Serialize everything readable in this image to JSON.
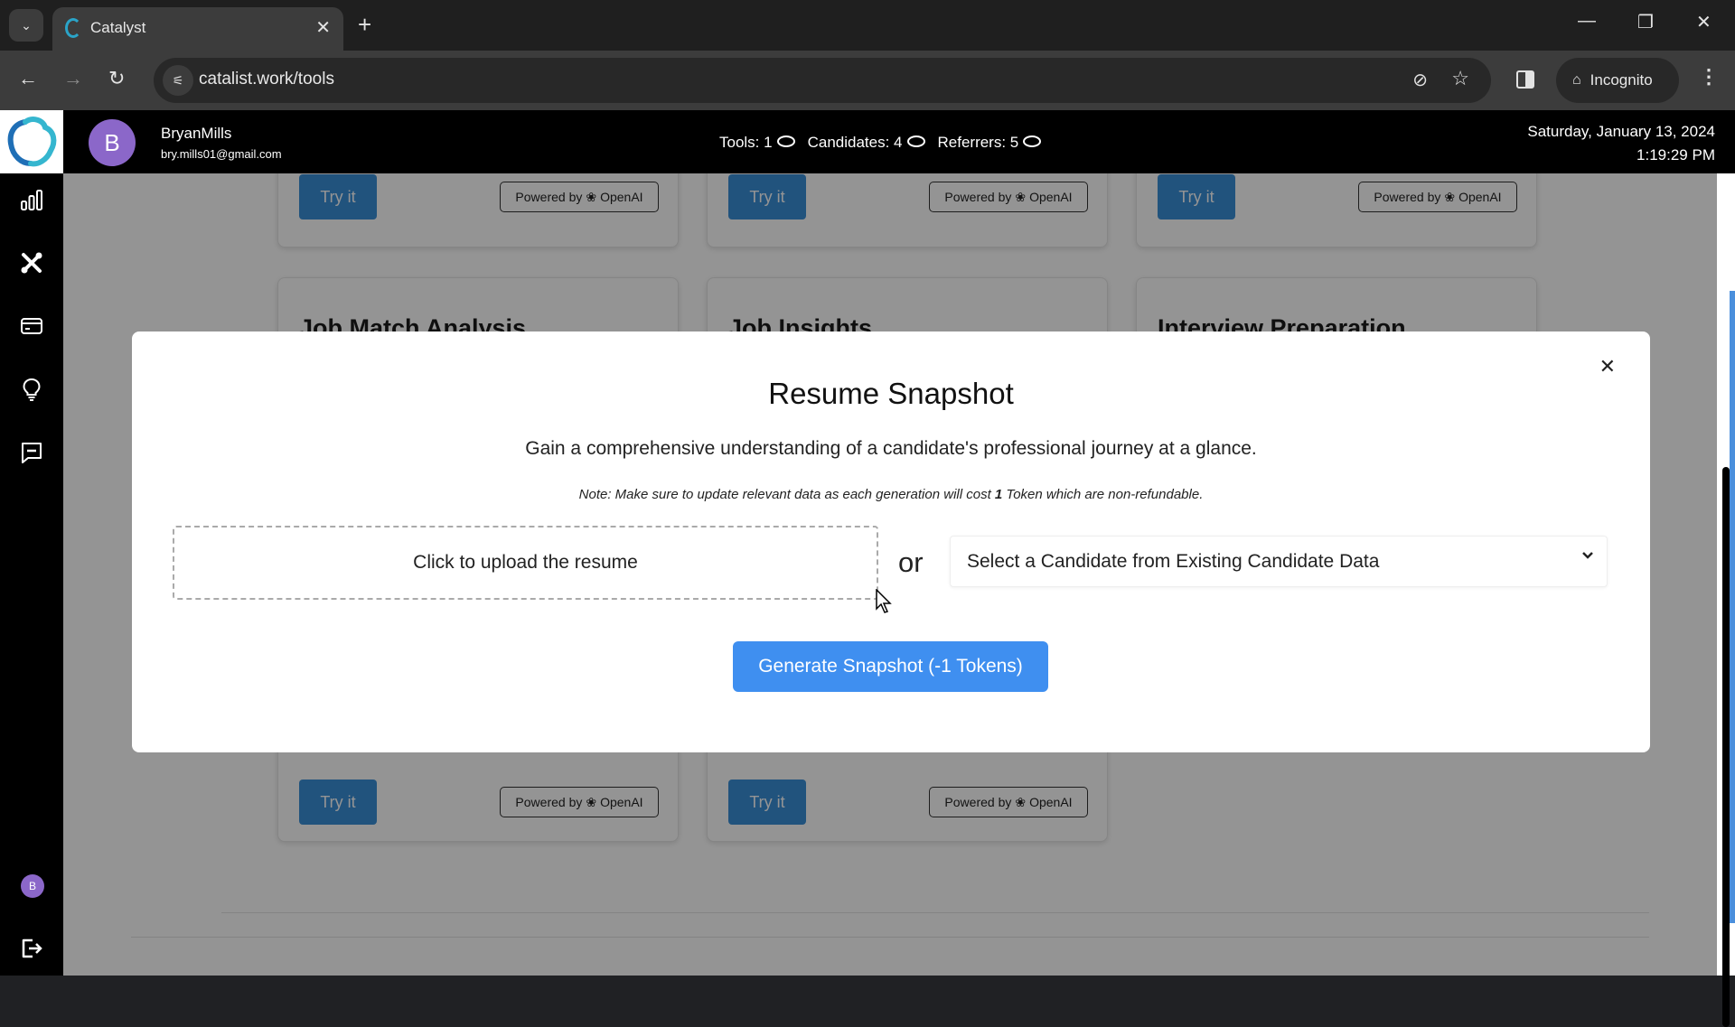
{
  "browser": {
    "tab_title": "Catalyst",
    "url": "catalist.work/tools",
    "incognito_label": "Incognito",
    "icons": {
      "tab_list": "chevron-down-icon",
      "tab_close": "close-icon",
      "new_tab": "plus-icon",
      "back": "arrow-left-icon",
      "forward": "arrow-right-icon",
      "reload": "reload-icon",
      "site_info": "tune-icon",
      "tracking": "eye-off-icon",
      "bookmark": "star-icon",
      "side_panel": "side-panel-icon",
      "incognito": "incognito-icon",
      "menu": "more-vertical-icon",
      "minimize": "minimize-icon",
      "restore": "restore-icon",
      "close_window": "close-icon"
    },
    "glyphs": {
      "tab_list": "⌄",
      "tab_close": "✕",
      "new_tab": "+",
      "back": "←",
      "forward": "→",
      "reload": "↻",
      "site_info": "⚟",
      "tracking": "⊘",
      "bookmark": "☆",
      "incognito": "🕵",
      "menu": "⋮",
      "minimize": "—",
      "restore": "❐",
      "close_window": "✕"
    }
  },
  "header": {
    "avatar_initial": "B",
    "user_name": "BryanMills",
    "user_email": "bry.mills01@gmail.com",
    "counters": [
      {
        "label": "Tools: 1"
      },
      {
        "label": "Candidates: 4"
      },
      {
        "label": "Referrers: 5"
      }
    ],
    "date": "Saturday, January 13, 2024",
    "time": "1:19:29 PM"
  },
  "sidebar": {
    "items": [
      {
        "name": "analytics",
        "icon": "bar-chart-icon"
      },
      {
        "name": "tools",
        "icon": "tools-icon"
      },
      {
        "name": "billing",
        "icon": "credit-card-icon"
      },
      {
        "name": "ideas",
        "icon": "lightbulb-icon"
      },
      {
        "name": "messages",
        "icon": "message-icon"
      }
    ],
    "avatar_initial": "B",
    "logout_icon": "logout-icon"
  },
  "background_cards": {
    "try_label": "Try it",
    "powered_label": "Powered by",
    "powered_brand": "OpenAI",
    "titles": [
      "Job Match Analysis",
      "Job Insights",
      "Interview Preparation"
    ]
  },
  "modal": {
    "title": "Resume Snapshot",
    "subtitle": "Gain a comprehensive understanding of a candidate's professional journey at a glance.",
    "note_prefix": "Note: Make sure to update relevant data as each generation will cost ",
    "note_count": "1",
    "note_suffix": " Token which are non-refundable.",
    "upload_label": "Click to upload the resume",
    "or_label": "or",
    "select_placeholder": "Select a Candidate from Existing Candidate Data",
    "generate_label": "Generate Snapshot (-1 Tokens)",
    "close_glyph": "✕"
  }
}
